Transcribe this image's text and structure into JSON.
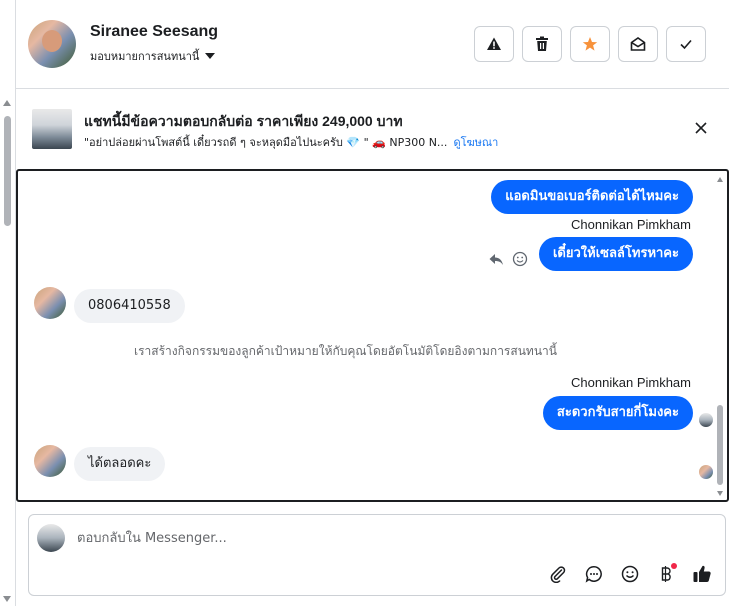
{
  "header": {
    "contact_name": "Siranee Seesang",
    "assign_label": "มอบหมายการสนทนานี้",
    "buttons": [
      "warning-icon",
      "trash-icon",
      "star-icon",
      "mail-open-icon",
      "check-icon"
    ],
    "colors": {
      "star": "#f7923b"
    }
  },
  "ad": {
    "title": "แชทนี้มีข้อความตอบกลับต่อ ราคาเพียง 249,000 บาท",
    "subtitle": "\"อย่าปล่อยผ่านโพสต์นี้ เดี๋ยวรถดี ๆ จะหลุดมือไปนะครับ 💎 \" 🚗 NP300 N...",
    "link": "ดูโฆษณา"
  },
  "chat": {
    "messages": [
      {
        "dir": "out",
        "text": "แอดมินขอเบอร์ติดต่อได้ไหมคะ"
      },
      {
        "sender": "Chonnikan Pimkham"
      },
      {
        "dir": "out",
        "text": "เดี๋ยวให้เซลล์โทรหาคะ"
      },
      {
        "dir": "in",
        "text": "0806410558"
      },
      {
        "system": "เราสร้างกิจกรรมของลูกค้าเป้าหมายให้กับคุณโดยอัตโนมัติโดยอิงตามการสนทนานี้"
      },
      {
        "sender": "Chonnikan Pimkham"
      },
      {
        "dir": "out",
        "text": "สะดวกรับสายกี่โมงคะ"
      },
      {
        "dir": "in",
        "text": "ได้ตลอดคะ"
      }
    ],
    "colors": {
      "outgoing": "#0866ff",
      "incoming": "#f0f2f5"
    }
  },
  "composer": {
    "placeholder": "ตอบกลับใน Messenger...",
    "tools": [
      "paperclip-icon",
      "chat-bubble-icon",
      "emoji-icon",
      "baht-icon",
      "thumbs-up-icon"
    ]
  }
}
